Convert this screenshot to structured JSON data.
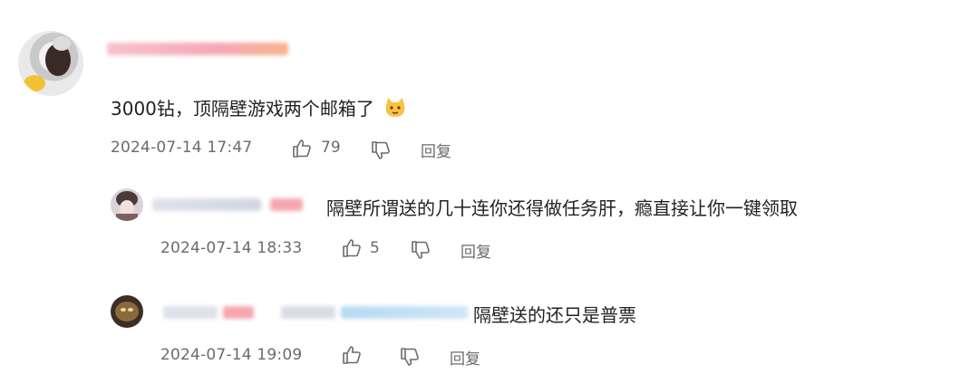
{
  "comments": [
    {
      "text": "3000钻，顶隔壁游戏两个邮箱了",
      "emoji": "cat-face-emoji",
      "timestamp": "2024-07-14 17:47",
      "likes": "79",
      "reply_label": "回复"
    },
    {
      "text": "隔壁所谓送的几十连你还得做任务肝，瘾直接让你一键领取",
      "timestamp": "2024-07-14 18:33",
      "likes": "5",
      "reply_label": "回复"
    },
    {
      "text": "隔壁送的还只是普票",
      "timestamp": "2024-07-14 19:09",
      "reply_label": "回复"
    }
  ],
  "icons": [
    "thumbs-up-icon",
    "thumbs-down-icon"
  ],
  "colors": {
    "text": "#222222",
    "meta": "#6b6b6b",
    "blur_pink": "#f6b3bd",
    "blur_blue": "#b9dcf3"
  }
}
